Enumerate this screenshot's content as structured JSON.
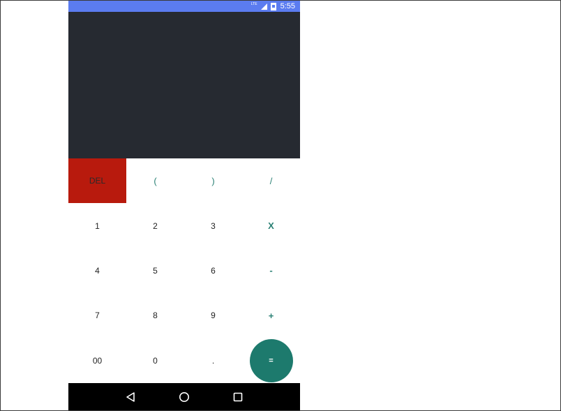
{
  "status_bar": {
    "network_label": "LTE",
    "time": "5:55",
    "icons": [
      "lte-icon",
      "signal-icon",
      "battery-icon"
    ]
  },
  "display": {
    "expression": "",
    "result": ""
  },
  "keypad": {
    "rows": [
      [
        {
          "label": "DEL",
          "name": "del-button",
          "type": "del"
        },
        {
          "label": "(",
          "name": "open-paren-button",
          "type": "op"
        },
        {
          "label": ")",
          "name": "close-paren-button",
          "type": "op"
        },
        {
          "label": "/",
          "name": "divide-button",
          "type": "op"
        }
      ],
      [
        {
          "label": "1",
          "name": "digit-1-button",
          "type": "num"
        },
        {
          "label": "2",
          "name": "digit-2-button",
          "type": "num"
        },
        {
          "label": "3",
          "name": "digit-3-button",
          "type": "num"
        },
        {
          "label": "X",
          "name": "multiply-button",
          "type": "opbold"
        }
      ],
      [
        {
          "label": "4",
          "name": "digit-4-button",
          "type": "num"
        },
        {
          "label": "5",
          "name": "digit-5-button",
          "type": "num"
        },
        {
          "label": "6",
          "name": "digit-6-button",
          "type": "num"
        },
        {
          "label": "-",
          "name": "minus-button",
          "type": "opbold"
        }
      ],
      [
        {
          "label": "7",
          "name": "digit-7-button",
          "type": "num"
        },
        {
          "label": "8",
          "name": "digit-8-button",
          "type": "num"
        },
        {
          "label": "9",
          "name": "digit-9-button",
          "type": "num"
        },
        {
          "label": "+",
          "name": "plus-button",
          "type": "opbold"
        }
      ],
      [
        {
          "label": "00",
          "name": "double-zero-button",
          "type": "num"
        },
        {
          "label": "0",
          "name": "digit-0-button",
          "type": "num"
        },
        {
          "label": ".",
          "name": "decimal-button",
          "type": "num"
        },
        {
          "label": "=",
          "name": "equals-button",
          "type": "eq"
        }
      ]
    ]
  },
  "nav_bar": {
    "buttons": [
      "back-icon",
      "home-icon",
      "recents-icon"
    ]
  },
  "colors": {
    "status_bar": "#5b7cf0",
    "display_bg": "#262a31",
    "del_bg": "#b81a0d",
    "accent": "#1d7a6d",
    "operator_text": "#2a8074",
    "nav_bar": "#000000"
  }
}
